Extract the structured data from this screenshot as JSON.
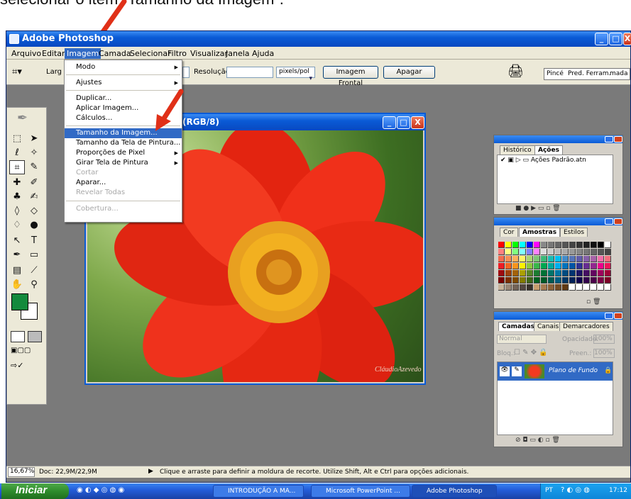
{
  "caption": "selecionar o item “Tamanho da Imagem”.",
  "window": {
    "title": "Adobe Photoshop",
    "min": "_",
    "max": "□",
    "close": "X"
  },
  "menubar": [
    "Arquivo",
    "Editar",
    "Imagem",
    "Camada",
    "Selecionar",
    "Filtro",
    "Visualizar",
    "Janela",
    "Ajuda"
  ],
  "options": {
    "width_label": "Larg",
    "resolution_label": "Resolução:",
    "unit": "pixels/pol",
    "front_button": "Imagem Frontal",
    "clear_button": "Apagar",
    "tabs": [
      "Pincé",
      "Pred. Ferram.",
      "mada"
    ]
  },
  "image_menu": {
    "items": [
      {
        "label": "Modo",
        "sub": true
      },
      {
        "label": "Ajustes",
        "sub": true
      },
      {
        "label": "Duplicar..."
      },
      {
        "label": "Aplicar Imagem..."
      },
      {
        "label": "Cálculos..."
      },
      {
        "label": "Tamanho da Imagem...",
        "selected": true
      },
      {
        "label": "Tamanho da Tela de Pintura..."
      },
      {
        "label": "Proporções de Pixel",
        "sub": true
      },
      {
        "label": "Girar Tela de Pintura",
        "sub": true
      },
      {
        "label": "Cortar",
        "disabled": true
      },
      {
        "label": "Aparar..."
      },
      {
        "label": "Revelar Todas",
        "disabled": true
      },
      {
        "label": "Cobertura...",
        "disabled": true
      }
    ]
  },
  "document": {
    "title": "(RGB/8)",
    "signature": "CláudioAzevedo"
  },
  "history_panel": {
    "tabs": [
      "Histórico",
      "Ações"
    ],
    "row": "Ações Padrão.atn"
  },
  "color_panel": {
    "tabs": [
      "Cor",
      "Amostras",
      "Estilos"
    ]
  },
  "layers_panel": {
    "tabs": [
      "Camadas",
      "Canais",
      "Demarcadores"
    ],
    "blend": "Normal",
    "opacity_label": "Opacidade:",
    "opacity": "100%",
    "lock_label": "Bloq.:",
    "fill_label": "Preen.:",
    "fill": "100%",
    "layer": "Plano de Fundo"
  },
  "status": {
    "zoom": "16,67%",
    "doc": "Doc: 22,9M/22,9M",
    "hint": "Clique e arraste para definir a moldura de recorte. Utilize Shift, Alt e Ctrl para opções adicionais."
  },
  "taskbar": {
    "start": "Iniciar",
    "tasks": [
      "INTRODUÇÃO A MA...",
      "Microsoft PowerPoint ...",
      "Adobe Photoshop"
    ],
    "lang": "PT",
    "clock": "17:12"
  },
  "colors": {
    "accent": "#316ac5",
    "titlebar": "#0a5bd6",
    "arrow": "#e03018"
  }
}
